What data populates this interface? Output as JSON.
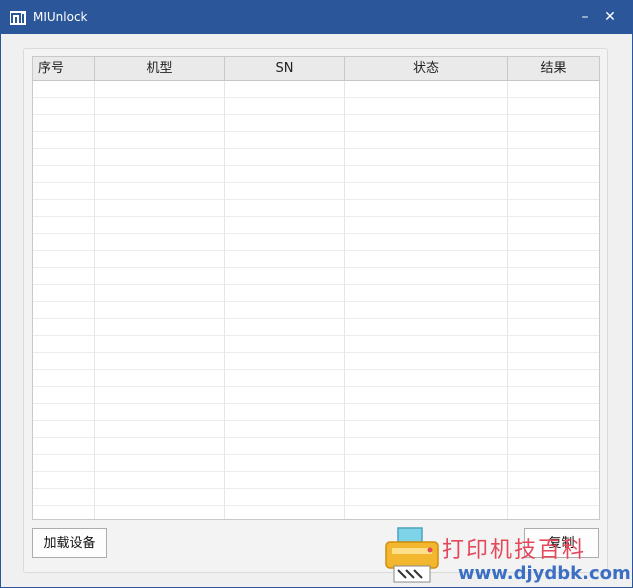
{
  "window": {
    "title": "MIUnlock",
    "minimize_glyph": "–",
    "close_glyph": "✕"
  },
  "table": {
    "columns": [
      "序号",
      "机型",
      "SN",
      "状态",
      "结果"
    ],
    "rows": []
  },
  "buttons": {
    "load_label": "加载设备",
    "copy_label": "复制"
  },
  "watermark": {
    "text": "打印机技百科",
    "url": "www.djydbk.com"
  },
  "colors": {
    "titlebar": "#2b579a",
    "client": "#f0f0f0",
    "watermark_red": "#e5485b",
    "watermark_blue": "#3b6fc4"
  },
  "icons": [
    "mi-logo-icon",
    "minimize-icon",
    "close-icon",
    "printer-icon"
  ]
}
